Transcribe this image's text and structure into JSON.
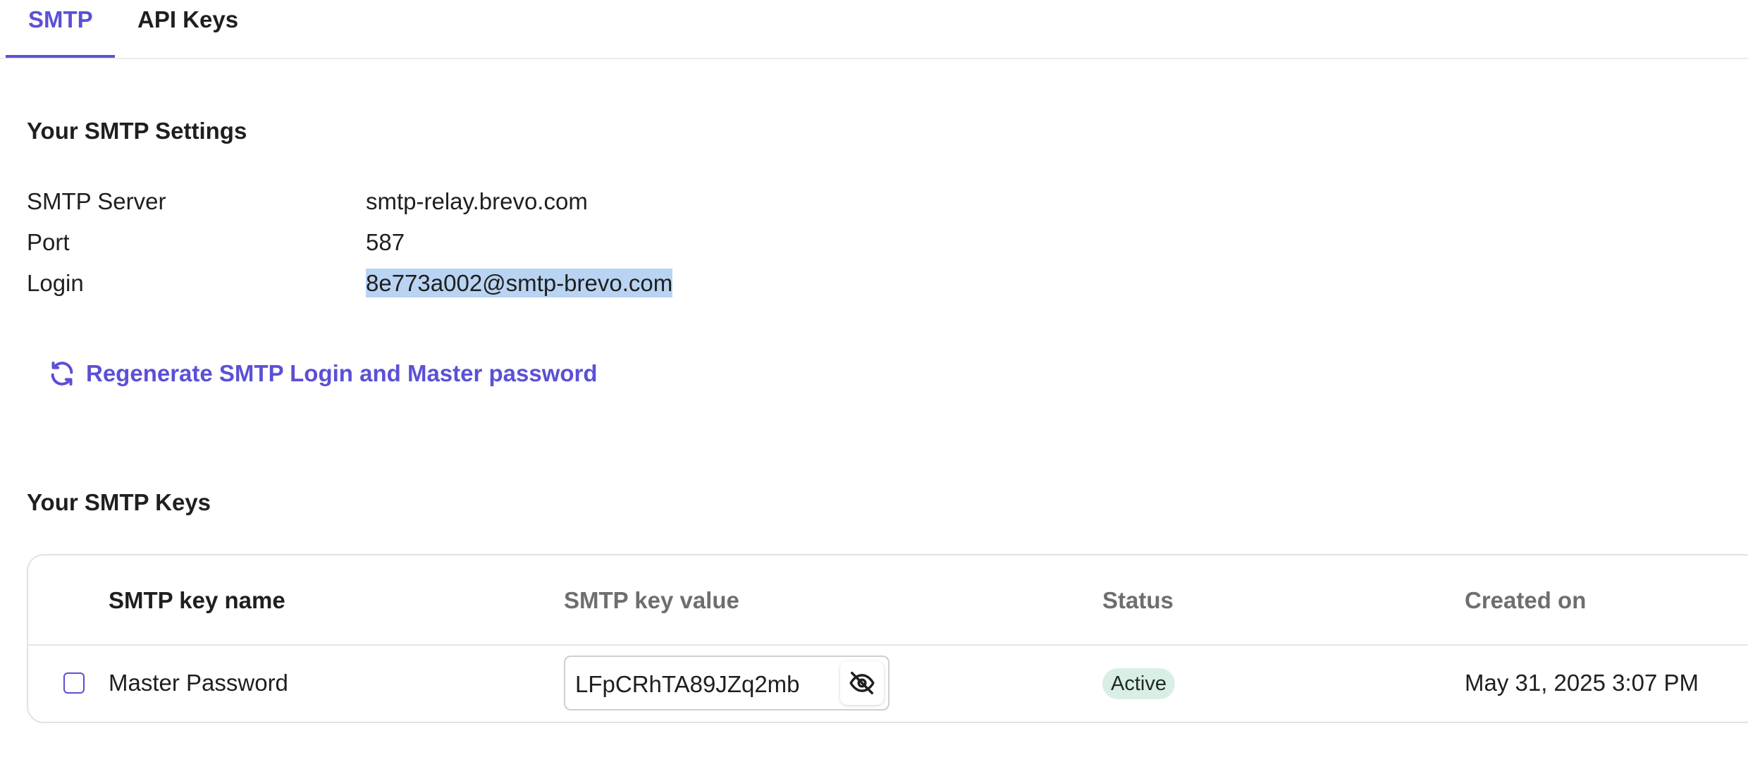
{
  "tabs": [
    {
      "label": "SMTP",
      "active": true
    },
    {
      "label": "API Keys",
      "active": false
    }
  ],
  "settings": {
    "title": "Your SMTP Settings",
    "rows": [
      {
        "label": "SMTP Server",
        "value": "smtp-relay.brevo.com"
      },
      {
        "label": "Port",
        "value": "587"
      },
      {
        "label": "Login",
        "value": "8e773a002@smtp-brevo.com",
        "selected": true
      }
    ],
    "regenerate_label": "Regenerate SMTP Login and Master password",
    "regenerate_icon": "refresh-icon"
  },
  "keys": {
    "title": "Your SMTP Keys",
    "columns": [
      "SMTP key name",
      "SMTP key value",
      "Status",
      "Created on"
    ],
    "rows": [
      {
        "name": "Master Password",
        "value": "LFpCRhTA89JZq2mb",
        "visibility_icon": "eye-off-icon",
        "status": "Active",
        "created_on": "May 31, 2025 3:07 PM"
      }
    ]
  },
  "colors": {
    "accent": "#5b50d6",
    "selection": "#b9d4f3",
    "status_active_bg": "#d9efe6"
  }
}
